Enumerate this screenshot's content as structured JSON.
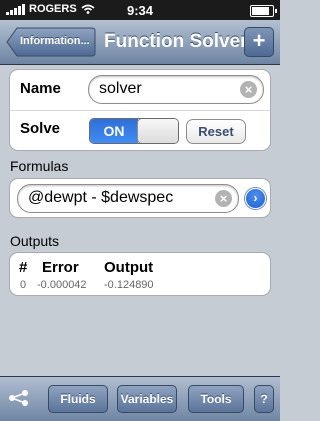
{
  "status": {
    "carrier": "ROGERS",
    "time": "9:34"
  },
  "nav": {
    "back_label": "Information...",
    "title": "Function Solver",
    "add_label": "+"
  },
  "solver": {
    "name_label": "Name",
    "name_value": "solver",
    "solve_label": "Solve",
    "toggle_on_label": "ON",
    "reset_label": "Reset"
  },
  "formulas": {
    "header": "Formulas",
    "value": "@dewpt - $dewspec"
  },
  "outputs": {
    "header": "Outputs",
    "columns": [
      "#",
      "Error",
      "Output"
    ],
    "row": [
      "0",
      "-0.000042",
      "-0.124890"
    ]
  },
  "toolbar": {
    "fluids": "Fluids",
    "variables": "Variables",
    "tools": "Tools",
    "help": "?"
  },
  "colors": {
    "nav": "#6d84a2",
    "background": "#c5ccd4",
    "toggle_on": "#3f8cf4"
  }
}
